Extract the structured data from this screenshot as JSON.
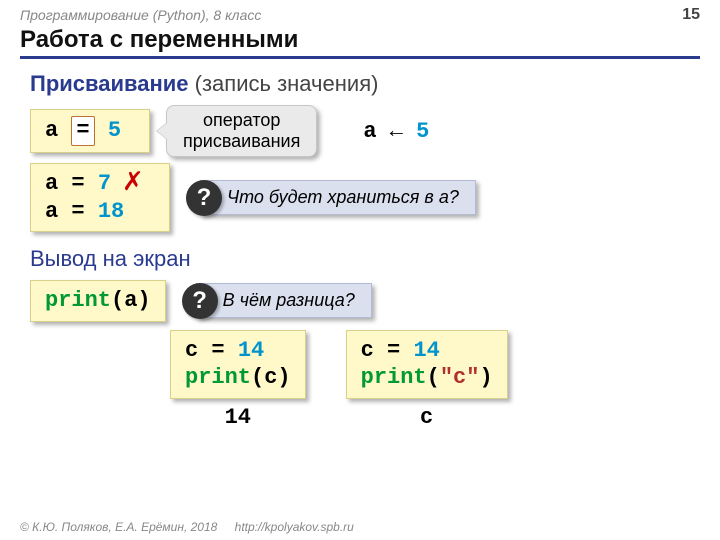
{
  "header": {
    "course": "Программирование (Python), 8 класс",
    "page": "15"
  },
  "title": "Работа с переменными",
  "section1": {
    "heading_bold": "Присваивание",
    "heading_rest": " (запись значения)",
    "assign_var": "a",
    "assign_eq": "=",
    "assign_val": "5",
    "callout_line1": "оператор",
    "callout_line2": "присваивания",
    "arrow_text": "a ← ",
    "arrow_val": "5",
    "reassign_l1_a": "a = ",
    "reassign_l1_b": "7",
    "reassign_l2_a": "a = ",
    "reassign_l2_b": "18",
    "q_mark": "?",
    "q_text": "Что будет храниться в a?"
  },
  "section2": {
    "heading": "Вывод на экран",
    "print_fn": "print",
    "print_arg_open": "(",
    "print_arg": "a",
    "print_arg_close": ")",
    "q_mark": "?",
    "q_text": "В чём разница?",
    "ex1_l1a": "c = ",
    "ex1_l1b": "14",
    "ex1_l2a": "print",
    "ex1_l2b": "(c)",
    "ex1_out": "14",
    "ex2_l1a": "c = ",
    "ex2_l1b": "14",
    "ex2_l2a": "print",
    "ex2_l2b": "(",
    "ex2_l2c": "\"c\"",
    "ex2_l2d": ")",
    "ex2_out": "c"
  },
  "footer": {
    "copyright": "© К.Ю. Поляков, Е.А. Ерёмин, 2018",
    "url": "http://kpolyakov.spb.ru"
  }
}
